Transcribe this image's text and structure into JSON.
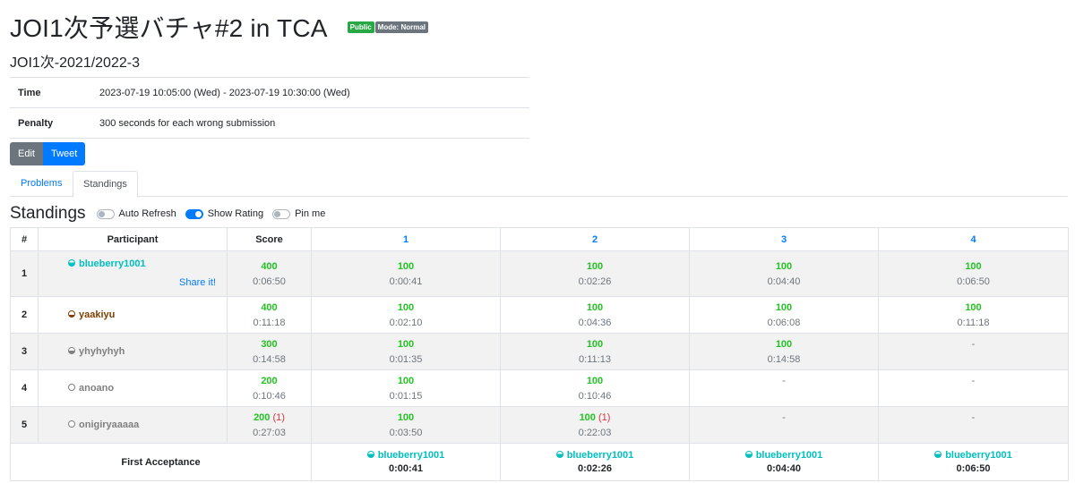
{
  "header": {
    "title": "JOI1次予選バチャ#2 in TCA",
    "badge_public": "Public",
    "badge_mode": "Mode: Normal",
    "subtitle": "JOI1次-2021/2022-3"
  },
  "info": {
    "time_label": "Time",
    "time_value": "2023-07-19 10:05:00 (Wed) - 2023-07-19 10:30:00 (Wed)",
    "penalty_label": "Penalty",
    "penalty_value": "300 seconds for each wrong submission"
  },
  "buttons": {
    "edit": "Edit",
    "tweet": "Tweet"
  },
  "tabs": {
    "problems": "Problems",
    "standings": "Standings"
  },
  "standings_bar": {
    "heading": "Standings",
    "auto_refresh": "Auto Refresh",
    "show_rating": "Show Rating",
    "pin_me": "Pin me",
    "auto_refresh_on": false,
    "show_rating_on": true,
    "pin_me_on": false
  },
  "table": {
    "headers": {
      "rank": "#",
      "participant": "Participant",
      "score": "Score",
      "p1": "1",
      "p2": "2",
      "p3": "3",
      "p4": "4"
    },
    "share": "Share it!",
    "rows": [
      {
        "rank": "1",
        "name": "blueberry1001",
        "color": "#00c0c0",
        "score": "400",
        "time": "0:06:50",
        "p1": {
          "score": "100",
          "time": "0:00:41"
        },
        "p2": {
          "score": "100",
          "time": "0:02:26"
        },
        "p3": {
          "score": "100",
          "time": "0:04:40"
        },
        "p4": {
          "score": "100",
          "time": "0:06:50"
        }
      },
      {
        "rank": "2",
        "name": "yaakiyu",
        "color": "#804000",
        "score": "400",
        "time": "0:11:18",
        "p1": {
          "score": "100",
          "time": "0:02:10"
        },
        "p2": {
          "score": "100",
          "time": "0:04:36"
        },
        "p3": {
          "score": "100",
          "time": "0:06:08"
        },
        "p4": {
          "score": "100",
          "time": "0:11:18"
        }
      },
      {
        "rank": "3",
        "name": "yhyhyhyh",
        "color": "#808080",
        "score": "300",
        "time": "0:14:58",
        "p1": {
          "score": "100",
          "time": "0:01:35"
        },
        "p2": {
          "score": "100",
          "time": "0:11:13"
        },
        "p3": {
          "score": "100",
          "time": "0:14:58"
        },
        "p4": {
          "dash": "-"
        }
      },
      {
        "rank": "4",
        "name": "anoano",
        "color": "#808080",
        "score": "200",
        "time": "0:10:46",
        "p1": {
          "score": "100",
          "time": "0:01:15"
        },
        "p2": {
          "score": "100",
          "time": "0:10:46"
        },
        "p3": {
          "dash": "-"
        },
        "p4": {
          "dash": "-"
        }
      },
      {
        "rank": "5",
        "name": "onigiryaaaaa",
        "color": "#808080",
        "score": "200",
        "penalty": "(1)",
        "time": "0:27:03",
        "p1": {
          "score": "100",
          "time": "0:03:50"
        },
        "p2": {
          "score": "100",
          "penalty": "(1)",
          "time": "0:22:03"
        },
        "p3": {
          "dash": "-"
        },
        "p4": {
          "dash": "-"
        }
      }
    ],
    "first_acceptance": {
      "label": "First Acceptance",
      "p1": {
        "name": "blueberry1001",
        "time": "0:00:41"
      },
      "p2": {
        "name": "blueberry1001",
        "time": "0:02:26"
      },
      "p3": {
        "name": "blueberry1001",
        "time": "0:04:40"
      },
      "p4": {
        "name": "blueberry1001",
        "time": "0:06:50"
      }
    }
  },
  "colors": {
    "accent": "#007bff",
    "accepted": "#22c322",
    "penalty": "#dc3545",
    "cyan_rating": "#00c0c0",
    "brown_rating": "#804000",
    "grey_rating": "#808080"
  }
}
